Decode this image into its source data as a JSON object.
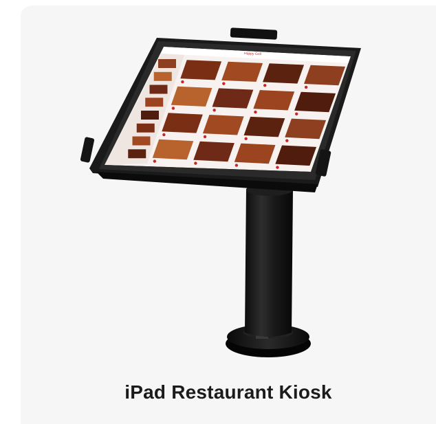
{
  "product": {
    "caption": "iPad Restaurant Kiosk",
    "accent_color": "#c62828",
    "stand_color": "#151515",
    "frame_color": "#1c1c1c"
  },
  "screen": {
    "app_title": "Happy Grill"
  }
}
